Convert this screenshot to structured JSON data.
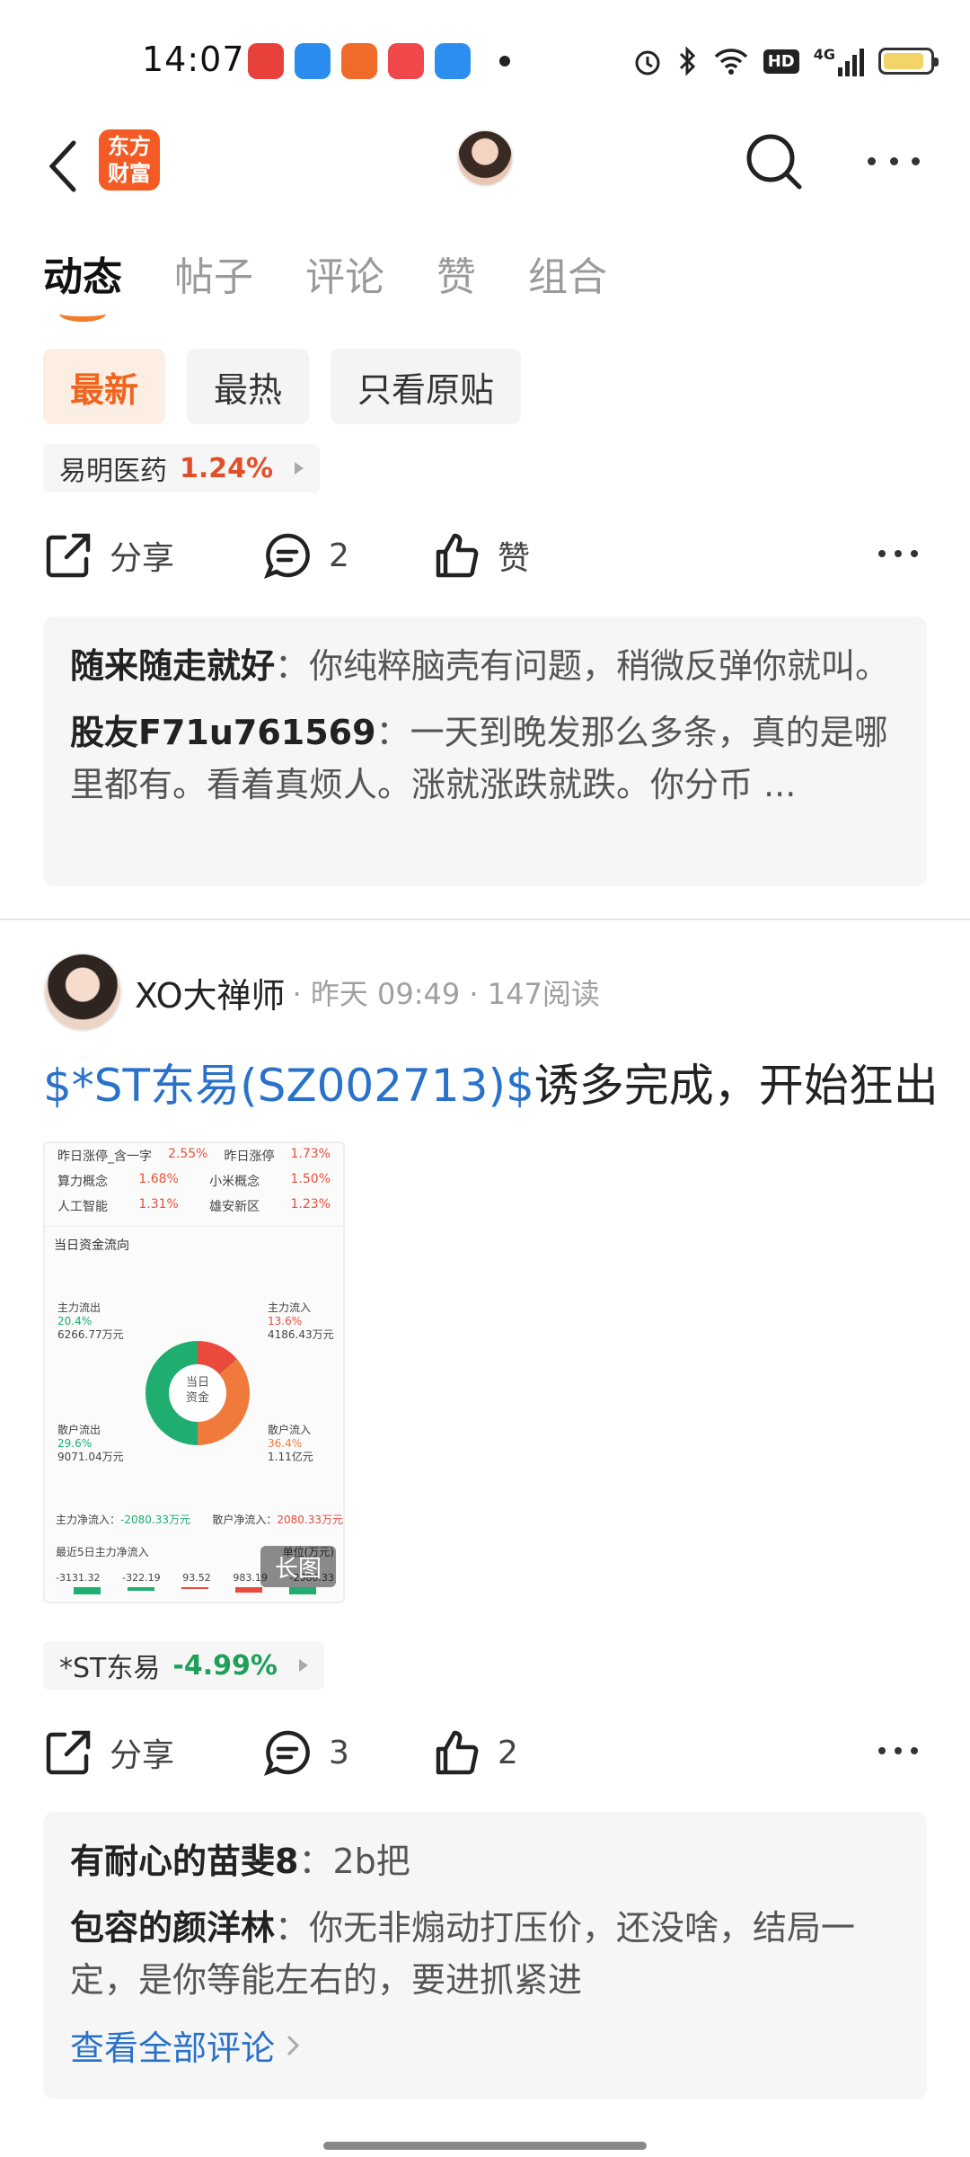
{
  "status_bar": {
    "time": "14:07",
    "network": "4G",
    "hd_label": "HD",
    "app_icon_colors": [
      "#e8403a",
      "#2b8cf0",
      "#f06a2a",
      "#f0474a",
      "#2c8ff0"
    ]
  },
  "header": {
    "brand_logo_line1": "东方",
    "brand_logo_line2": "财富",
    "brand_color": "#f45a23"
  },
  "tabs": [
    {
      "label": "动态",
      "active": true
    },
    {
      "label": "帖子",
      "active": false
    },
    {
      "label": "评论",
      "active": false
    },
    {
      "label": "赞",
      "active": false
    },
    {
      "label": "组合",
      "active": false
    }
  ],
  "filters": [
    {
      "label": "最新",
      "active": true
    },
    {
      "label": "最热",
      "active": false
    },
    {
      "label": "只看原贴",
      "active": false
    }
  ],
  "post1": {
    "stock_tag": {
      "name": "易明医药",
      "change": "1.24%",
      "color": "#e2502a"
    },
    "share_label": "分享",
    "comment_count": "2",
    "like_label": "赞",
    "comments": [
      {
        "author": "随来随走就好",
        "text": "你纯粹脑壳有问题，稍微反弹你就叫。"
      },
      {
        "author": "股友F71u761569",
        "text": "一天到晚发那么多条，真的是哪里都有。看着真烦人。涨就涨跌就跌。你分币 ..."
      }
    ]
  },
  "post2": {
    "username": "XO大禅师",
    "meta": " · 昨天 09:49 · 147阅读",
    "title_stock": "$*ST东易(SZ002713)$",
    "title_text": "诱多完成，开始狂出",
    "image": {
      "rows": [
        {
          "left_name": "昨日涨停_含一字",
          "left_val": "2.55%",
          "right_name": "昨日涨停",
          "right_val": "1.73%"
        },
        {
          "left_name": "算力概念",
          "left_val": "1.68%",
          "right_name": "小米概念",
          "right_val": "1.50%"
        },
        {
          "left_name": "人工智能",
          "left_val": "1.31%",
          "right_name": "雄安新区",
          "right_val": "1.23%"
        }
      ],
      "section_title": "当日资金流向",
      "center_label_1": "当日",
      "center_label_2": "资金",
      "main_out_label": "主力流出",
      "main_out_pct": "20.4%",
      "main_out_amt": "6266.77万元",
      "main_in_label": "主力流入",
      "main_in_pct": "13.6%",
      "main_in_amt": "4186.43万元",
      "retail_out_label": "散户流出",
      "retail_out_pct": "29.6%",
      "retail_out_amt": "9071.04万元",
      "retail_in_label": "散户流入",
      "retail_in_pct": "36.4%",
      "retail_in_amt": "1.11亿元",
      "main_net_label": "主力净流入：",
      "main_net_val": "-2080.33万元",
      "retail_net_label": "散户净流入：",
      "retail_net_val": "2080.33万元",
      "five_day_label": "最近5日主力净流入",
      "unit_label": "单位(万元)",
      "bar_values": [
        "-3131.32",
        "-322.19",
        "93.52",
        "983.19",
        "-2080.33"
      ],
      "long_image_tag": "长图"
    },
    "stock_tag": {
      "name": "*ST东易",
      "change": "-4.99%",
      "color": "#1fa05a"
    },
    "share_label": "分享",
    "comment_count": "3",
    "like_count": "2",
    "comments": [
      {
        "author": "有耐心的苗斐8",
        "text": "2b把"
      },
      {
        "author": "包容的颜洋林",
        "text": "你无非煽动打压价，还没啥，结局一定，是你等能左右的，要进抓紧进"
      }
    ],
    "view_all": "查看全部评论"
  }
}
